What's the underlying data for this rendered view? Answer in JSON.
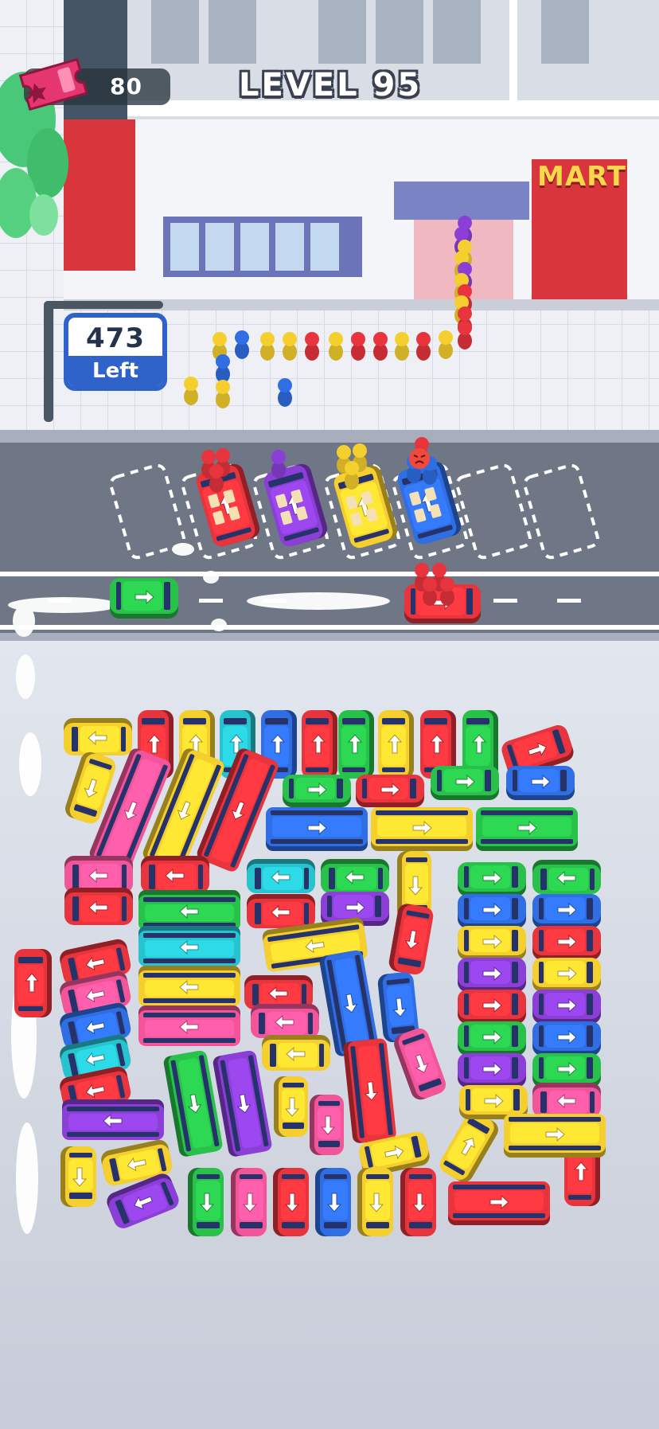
{
  "hud": {
    "coins": "80",
    "level": "LEVEL 95",
    "remaining_count": "473",
    "remaining_label": "Left",
    "store_sign": "MART"
  },
  "colors": {
    "red": "#e8343c",
    "pink": "#f2559a",
    "yellow": "#f5cf2e",
    "cyan": "#27c3cf",
    "blue": "#2f6ee3",
    "green": "#28c24a",
    "purple": "#8b3fd6"
  },
  "icons": [
    "ticket-icon",
    "arrow-icon",
    "angry-face-icon"
  ]
}
